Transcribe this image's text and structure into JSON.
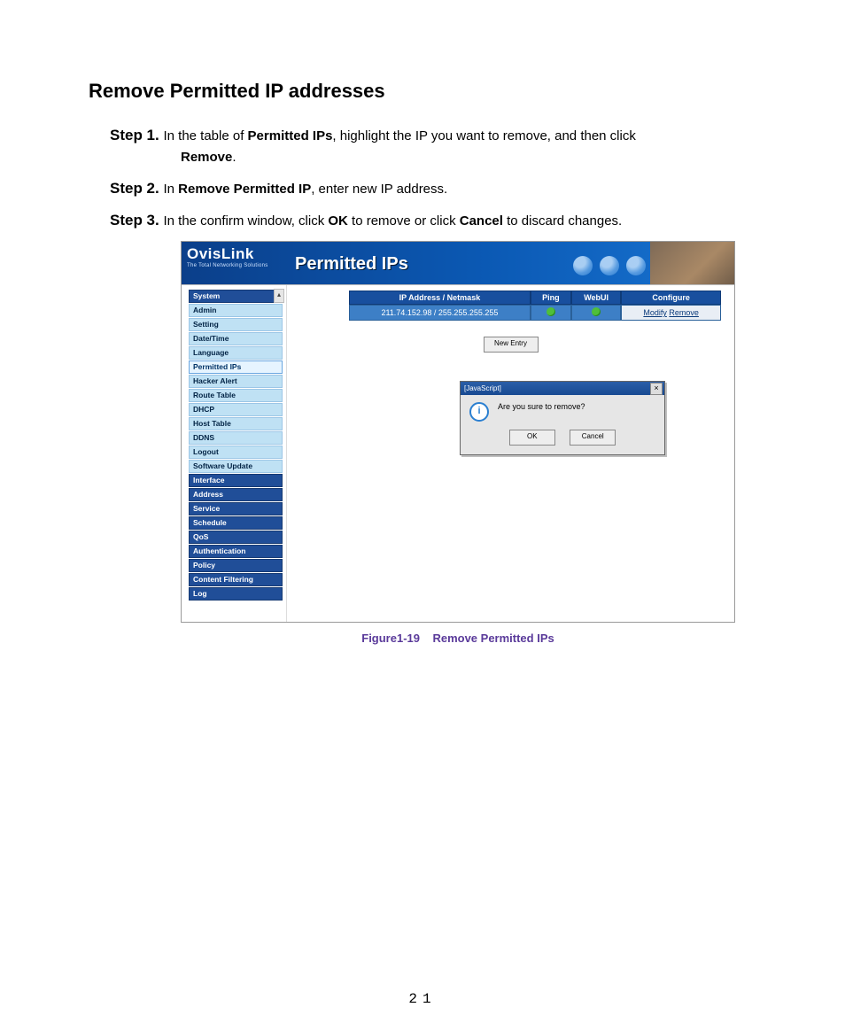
{
  "heading": "Remove Permitted IP addresses",
  "steps": [
    {
      "label": "Step 1. ",
      "pre": "In the table of ",
      "bold1": "Permitted IPs",
      "mid": ", highlight the IP you want to remove, and then click ",
      "cont_bold": "Remove",
      "cont_post": "."
    },
    {
      "label": "Step 2. ",
      "pre": "In ",
      "bold1": "Remove Permitted IP",
      "mid": ", enter new IP address."
    },
    {
      "label": "Step 3. ",
      "pre": "In the confirm window, click ",
      "bold1": "OK",
      "mid": " to remove or click ",
      "bold2": "Cancel",
      "post": " to discard changes."
    }
  ],
  "shot": {
    "brand": "OvisLink",
    "brand_sub": "The Total Networking Solutions",
    "title": "Permitted IPs",
    "sidebar": {
      "headers1": "System",
      "items1": [
        "Admin",
        "Setting",
        "Date/Time",
        "Language",
        "Permitted IPs",
        "Hacker Alert",
        "Route Table",
        "DHCP",
        "Host Table",
        "DDNS",
        "Logout",
        "Software Update"
      ],
      "selected": "Permitted IPs",
      "headers2": [
        "Interface",
        "Address",
        "Service",
        "Schedule",
        "QoS",
        "Authentication",
        "Policy",
        "Content Filtering",
        "Log"
      ]
    },
    "table": {
      "h_ip": "IP Address / Netmask",
      "h_ping": "Ping",
      "h_web": "WebUI",
      "h_cfg": "Configure",
      "row_ip": "211.74.152.98 / 255.255.255.255",
      "modify": "Modify",
      "remove": "Remove"
    },
    "new_entry": "New Entry",
    "dialog": {
      "title": "[JavaScript]",
      "msg": "Are you sure to remove?",
      "ok": "OK",
      "cancel": "Cancel"
    }
  },
  "caption_id": "Figure1-19",
  "caption_text": "Remove Permitted IPs",
  "page_number": "21"
}
